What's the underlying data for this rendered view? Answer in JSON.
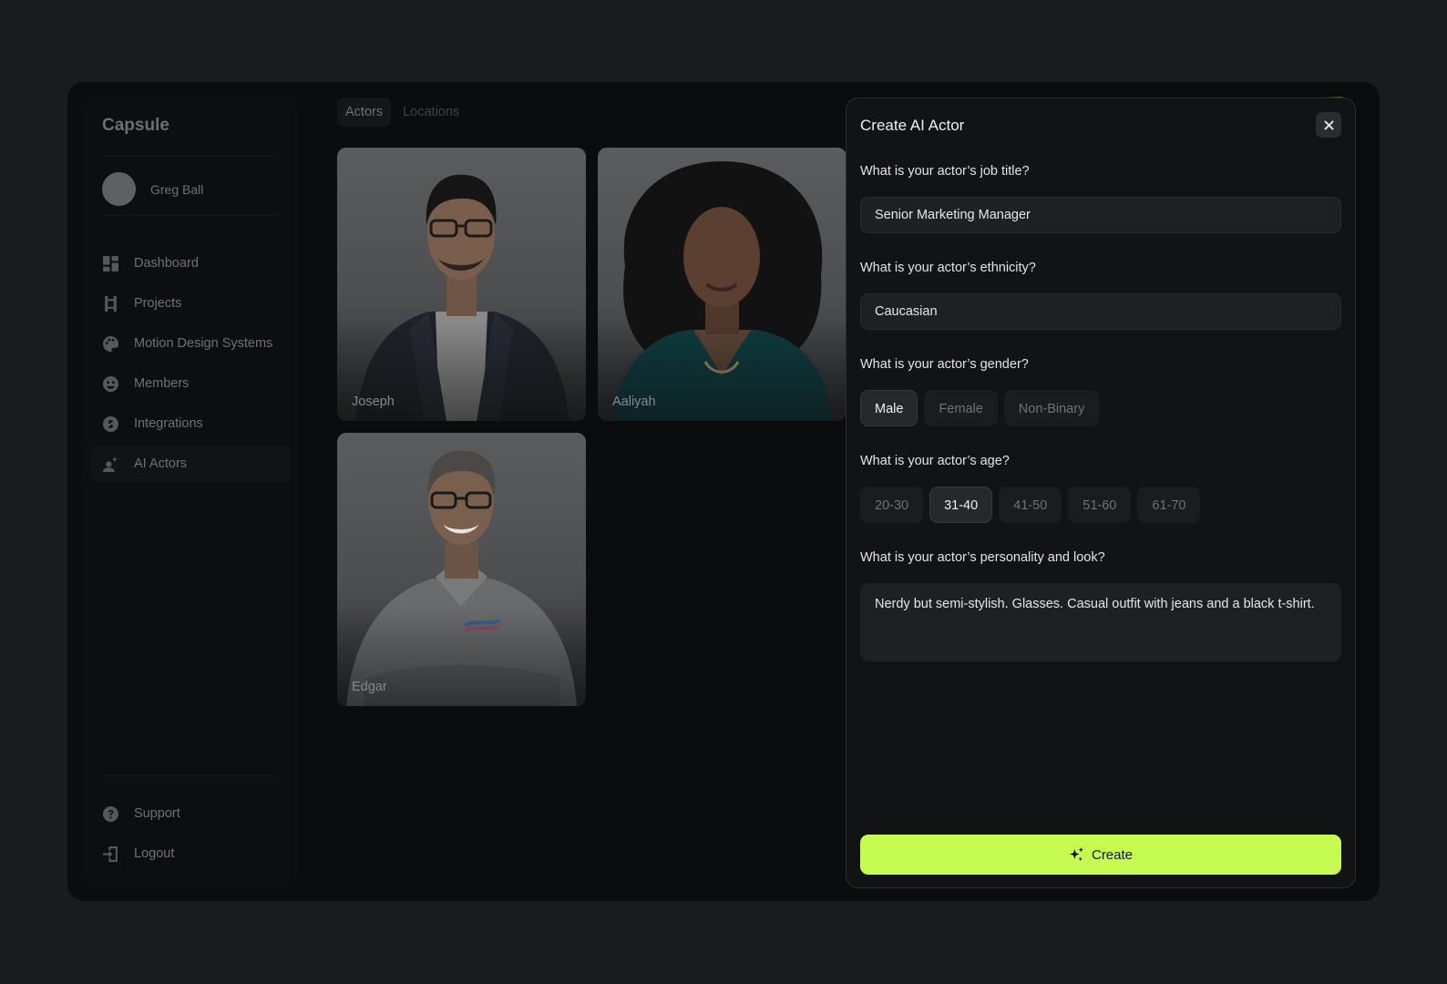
{
  "sidebar": {
    "brand": "Capsule",
    "user": {
      "name": "Greg Ball"
    },
    "nav": [
      {
        "label": "Dashboard",
        "icon": "dashboard-icon"
      },
      {
        "label": "Projects",
        "icon": "projects-icon"
      },
      {
        "label": "Motion Design Systems",
        "icon": "palette-icon"
      },
      {
        "label": "Members",
        "icon": "members-icon"
      },
      {
        "label": "Integrations",
        "icon": "integrations-icon"
      },
      {
        "label": "AI Actors",
        "icon": "ai-actor-icon",
        "active": true
      }
    ],
    "bottom": [
      {
        "label": "Support",
        "icon": "help-icon"
      },
      {
        "label": "Logout",
        "icon": "logout-icon"
      }
    ]
  },
  "tabs": [
    {
      "label": "Actors",
      "active": true
    },
    {
      "label": "Locations",
      "active": false
    }
  ],
  "actors": [
    {
      "name": "Joseph"
    },
    {
      "name": "Aaliyah"
    },
    {
      "name": "Edgar"
    }
  ],
  "panel": {
    "title": "Create AI Actor",
    "job_question": "What is your actor’s job title?",
    "job_value": "Senior Marketing Manager",
    "ethnicity_question": "What is your actor’s ethnicity?",
    "ethnicity_value": "Caucasian",
    "gender_question": "What is your actor’s gender?",
    "gender_options": [
      "Male",
      "Female",
      "Non-Binary"
    ],
    "gender_selected": "Male",
    "age_question": "What is your actor’s age?",
    "age_options": [
      "20-30",
      "31-40",
      "41-50",
      "51-60",
      "61-70"
    ],
    "age_selected": "31-40",
    "personality_question": "What is your actor’s personality and look?",
    "personality_value": "Nerdy but semi-stylish. Glasses. Casual outfit with jeans and a black t-shirt.",
    "create_label": "Create"
  },
  "colors": {
    "accent": "#c6fb50",
    "background": "#1a1b1d",
    "panel": "#121314"
  }
}
